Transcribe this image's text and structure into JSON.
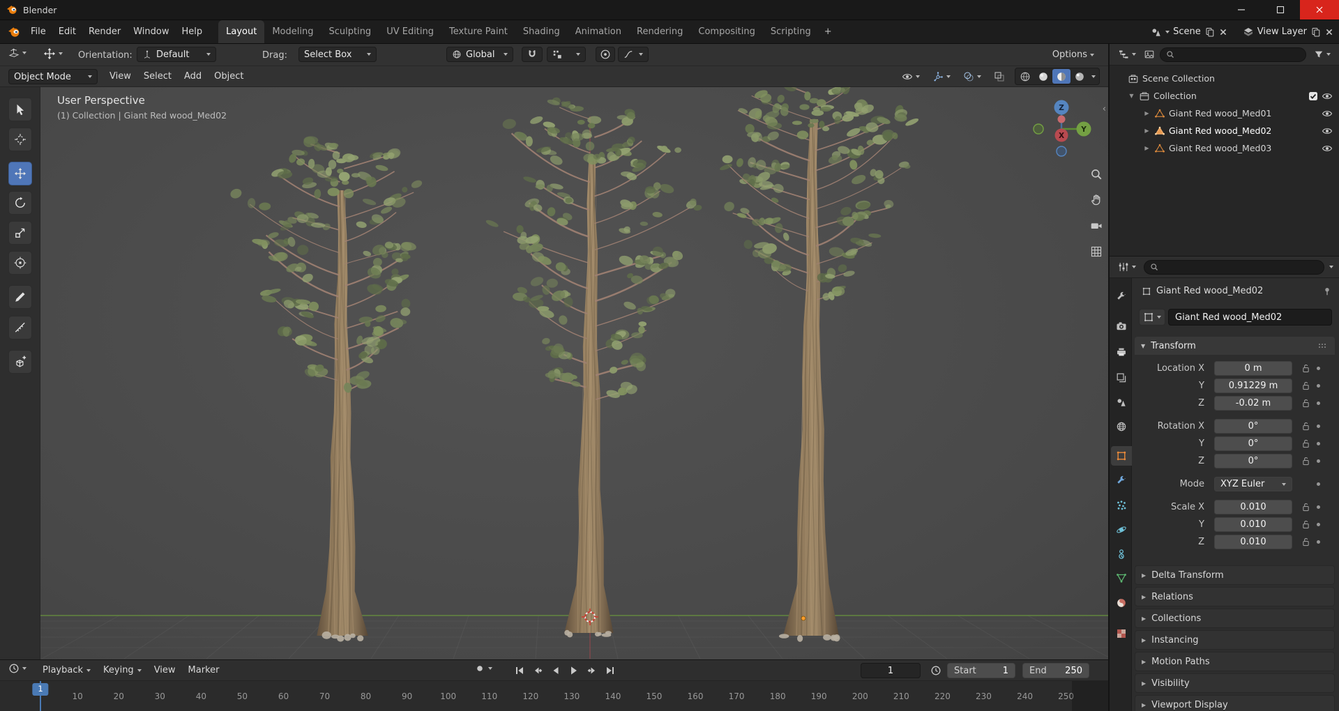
{
  "titlebar": {
    "title": "Blender",
    "controls": {
      "minimize": "minimize-icon",
      "maximize": "maximize-icon",
      "close": "close-icon"
    }
  },
  "topbar": {
    "menus": [
      "File",
      "Edit",
      "Render",
      "Window",
      "Help"
    ],
    "workspace_tabs": [
      "Layout",
      "Modeling",
      "Sculpting",
      "UV Editing",
      "Texture Paint",
      "Shading",
      "Animation",
      "Rendering",
      "Compositing",
      "Scripting"
    ],
    "active_tab": "Layout",
    "add_workspace_label": "+",
    "scene_selector": {
      "icon": "scene-icon",
      "label": "Scene"
    },
    "view_layer_selector": {
      "icon": "view-layer-icon",
      "label": "View Layer"
    }
  },
  "tool_settings": {
    "orientation": {
      "label": "Orientation:",
      "value": "Default"
    },
    "drag": {
      "label": "Drag:",
      "value": "Select Box"
    },
    "pivot": {
      "value": "Global"
    },
    "options_label": "Options"
  },
  "viewport_header": {
    "mode": {
      "value": "Object Mode"
    },
    "menus": [
      "View",
      "Select",
      "Add",
      "Object"
    ],
    "shading_modes": [
      "wireframe",
      "solid",
      "material-preview",
      "rendered"
    ],
    "active_shading": "material-preview"
  },
  "viewport": {
    "view_label": "User Perspective",
    "context_label": "(1) Collection | Giant Red wood_Med02",
    "gizmo": {
      "axes": [
        "Z",
        "Y",
        "X"
      ]
    }
  },
  "toolbar": {
    "tools": [
      {
        "name": "select-box",
        "icon": "select-box-icon"
      },
      {
        "name": "cursor",
        "icon": "cursor-icon"
      },
      {
        "name": "move",
        "icon": "move-tool-icon",
        "active": true
      },
      {
        "name": "rotate",
        "icon": "rotate-icon"
      },
      {
        "name": "scale",
        "icon": "scale-icon"
      },
      {
        "name": "transform",
        "icon": "transform-icon"
      },
      {
        "name": "annotate",
        "icon": "annotate-icon"
      },
      {
        "name": "measure",
        "icon": "measure-icon"
      },
      {
        "name": "add-cube",
        "icon": "add-cube-icon"
      }
    ]
  },
  "outliner": {
    "rows": [
      {
        "label": "Scene Collection",
        "depth": 0,
        "icon": "scene-collection-icon"
      },
      {
        "label": "Collection",
        "depth": 1,
        "icon": "collection-icon",
        "expander": "down",
        "checkbox": true,
        "eye": true
      },
      {
        "label": "Giant Red wood_Med01",
        "depth": 2,
        "icon": "mesh-icon",
        "expander": "right",
        "eye": true
      },
      {
        "label": "Giant Red wood_Med02",
        "depth": 2,
        "icon": "mesh-icon",
        "expander": "right",
        "eye": true,
        "active": true
      },
      {
        "label": "Giant Red wood_Med03",
        "depth": 2,
        "icon": "mesh-icon",
        "expander": "right",
        "eye": true
      }
    ]
  },
  "properties": {
    "tabs": [
      {
        "name": "tool",
        "icon": "tool-tab-icon"
      },
      {
        "name": "render",
        "icon": "render-tab-icon"
      },
      {
        "name": "output",
        "icon": "output-tab-icon"
      },
      {
        "name": "view-layer",
        "icon": "view-layer-tab-icon"
      },
      {
        "name": "scene",
        "icon": "scene-tab-icon"
      },
      {
        "name": "world",
        "icon": "world-tab-icon"
      },
      {
        "name": "object",
        "icon": "object-tab-icon",
        "active": true
      },
      {
        "name": "modifiers",
        "icon": "modifiers-tab-icon"
      },
      {
        "name": "particles",
        "icon": "particles-tab-icon"
      },
      {
        "name": "physics",
        "icon": "physics-tab-icon"
      },
      {
        "name": "constraints",
        "icon": "constraints-tab-icon"
      },
      {
        "name": "object-data",
        "icon": "object-data-tab-icon"
      },
      {
        "name": "material",
        "icon": "material-tab-icon"
      },
      {
        "name": "texture",
        "icon": "texture-tab-icon"
      }
    ],
    "breadcrumb": {
      "icon": "object-icon",
      "label": "Giant Red wood_Med02"
    },
    "name_field": {
      "icon": "object-icon",
      "value": "Giant Red wood_Med02"
    },
    "transform_panel": {
      "title": "Transform",
      "rows": [
        {
          "label": "Location X",
          "value": "0 m",
          "lock": true,
          "decorator": true
        },
        {
          "label": "Y",
          "value": "0.91229 m",
          "lock": true,
          "decorator": true
        },
        {
          "label": "Z",
          "value": "-0.02 m",
          "lock": true,
          "decorator": true,
          "group_end": true
        },
        {
          "label": "Rotation X",
          "value": "0°",
          "lock": true,
          "decorator": true
        },
        {
          "label": "Y",
          "value": "0°",
          "lock": true,
          "decorator": true
        },
        {
          "label": "Z",
          "value": "0°",
          "lock": true,
          "decorator": true,
          "group_end": true
        },
        {
          "label": "Mode",
          "value": "XYZ Euler",
          "dropdown": true,
          "decorator": true,
          "group_end": true
        },
        {
          "label": "Scale X",
          "value": "0.010",
          "lock": true,
          "decorator": true
        },
        {
          "label": "Y",
          "value": "0.010",
          "lock": true,
          "decorator": true
        },
        {
          "label": "Z",
          "value": "0.010",
          "lock": true,
          "decorator": true
        }
      ]
    },
    "collapsed_sections": [
      "Delta Transform",
      "Relations",
      "Collections",
      "Instancing",
      "Motion Paths",
      "Visibility",
      "Viewport Display"
    ]
  },
  "timeline": {
    "menus": [
      "Playback",
      "Keying",
      "View",
      "Marker"
    ],
    "current_frame": "1",
    "start": {
      "label": "Start",
      "value": "1"
    },
    "end": {
      "label": "End",
      "value": "250"
    },
    "ruler": {
      "ticks": [
        10,
        20,
        30,
        40,
        50,
        60,
        70,
        80,
        90,
        100,
        110,
        120,
        130,
        140,
        150,
        160,
        170,
        180,
        190,
        200,
        210,
        220,
        230,
        240,
        250
      ],
      "marker_frame": 1,
      "marker_label": "1"
    }
  },
  "colors": {
    "accent_blue": "#4772b3",
    "blender_orange": "#e8893a",
    "axis_green": "#71a83b",
    "axis_red": "#c4484f"
  }
}
